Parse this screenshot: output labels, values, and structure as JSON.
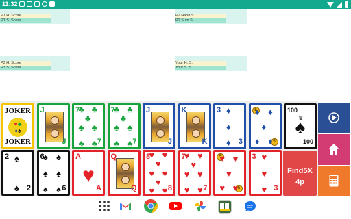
{
  "status_bar": {
    "time": "11:32",
    "icons": [
      "gmail-icon",
      "shield-icon",
      "calendar-icon",
      "accessibility-icon",
      "save-icon"
    ],
    "right_icons": [
      "wifi-icon",
      "signal-icon",
      "battery-icon"
    ]
  },
  "players": {
    "p1": {
      "hand_label": "P1 H. Score",
      "sum_label": "P1 S. Score"
    },
    "p2": {
      "hand_label": "P2 Hand S.",
      "sum_label": "P2 Sum S."
    },
    "p3": {
      "hand_label": "P3 H. Score",
      "sum_label": "P3 S. Score"
    },
    "you": {
      "hand_label": "Your H. S.",
      "sum_label": "Your S. S."
    }
  },
  "top_row": [
    {
      "type": "joker",
      "label_top": "JOKER",
      "label_bottom": "JOKER",
      "border": "#f4c400"
    },
    {
      "type": "court",
      "rank": "J",
      "suit": "♣",
      "color": "green",
      "border": "#17a33b"
    },
    {
      "type": "pips",
      "rank": "7",
      "suit": "♣",
      "color": "green",
      "border": "#17a33b"
    },
    {
      "type": "pips",
      "rank": "7",
      "suit": "♣",
      "color": "green",
      "border": "#17a33b"
    },
    {
      "type": "court",
      "rank": "J",
      "suit": "♦",
      "color": "blue",
      "border": "#1f4fa8"
    },
    {
      "type": "court",
      "rank": "K",
      "suit": "♦",
      "color": "blue",
      "border": "#1f4fa8"
    },
    {
      "type": "pips",
      "rank": "3",
      "suit": "♦",
      "color": "blue",
      "border": "#1f4fa8"
    },
    {
      "type": "coin",
      "rank": "5",
      "suit": "♦",
      "color": "blue",
      "border": "#1f4fa8"
    },
    {
      "type": "hundred",
      "rank": "100",
      "suit": "♠",
      "color": "black",
      "border": "#111111"
    }
  ],
  "bottom_row": [
    {
      "type": "pips",
      "rank": "2",
      "suit": "♠",
      "color": "black",
      "border": "#111111"
    },
    {
      "type": "pips",
      "rank": "6",
      "suit": "♠",
      "color": "black",
      "border": "#111111"
    },
    {
      "type": "ace",
      "rank": "A",
      "suit": "♥",
      "color": "red",
      "border": "#e2242a"
    },
    {
      "type": "court",
      "rank": "Q",
      "suit": "♥",
      "color": "red",
      "border": "#e2242a"
    },
    {
      "type": "pips",
      "rank": "8",
      "suit": "♥",
      "color": "red",
      "border": "#e2242a"
    },
    {
      "type": "pips",
      "rank": "7",
      "suit": "♥",
      "color": "red",
      "border": "#e2242a"
    },
    {
      "type": "coin",
      "rank": "5",
      "suit": "♥",
      "color": "red",
      "border": "#e2242a"
    },
    {
      "type": "pips",
      "rank": "3",
      "suit": "♥",
      "color": "red",
      "border": "#e2242a"
    }
  ],
  "promo": {
    "line1": "Find5X",
    "line2": "4p"
  },
  "side_buttons": [
    {
      "name": "play-button",
      "icon": "play-icon",
      "color": "#2b4f94"
    },
    {
      "name": "home-button",
      "icon": "home-icon",
      "color": "#d23c72"
    },
    {
      "name": "calculator-button",
      "icon": "calculator-icon",
      "color": "#f07a2c"
    }
  ],
  "dock": [
    {
      "name": "app-drawer",
      "icon": "grid-icon"
    },
    {
      "name": "gmail-app",
      "icon": "gmail-icon"
    },
    {
      "name": "chrome-app",
      "icon": "chrome-icon"
    },
    {
      "name": "youtube-app",
      "icon": "youtube-icon"
    },
    {
      "name": "photos-app",
      "icon": "pinwheel-icon"
    },
    {
      "name": "find5x-app",
      "icon": "find5x-icon"
    },
    {
      "name": "messages-app",
      "icon": "chat-icon"
    }
  ]
}
